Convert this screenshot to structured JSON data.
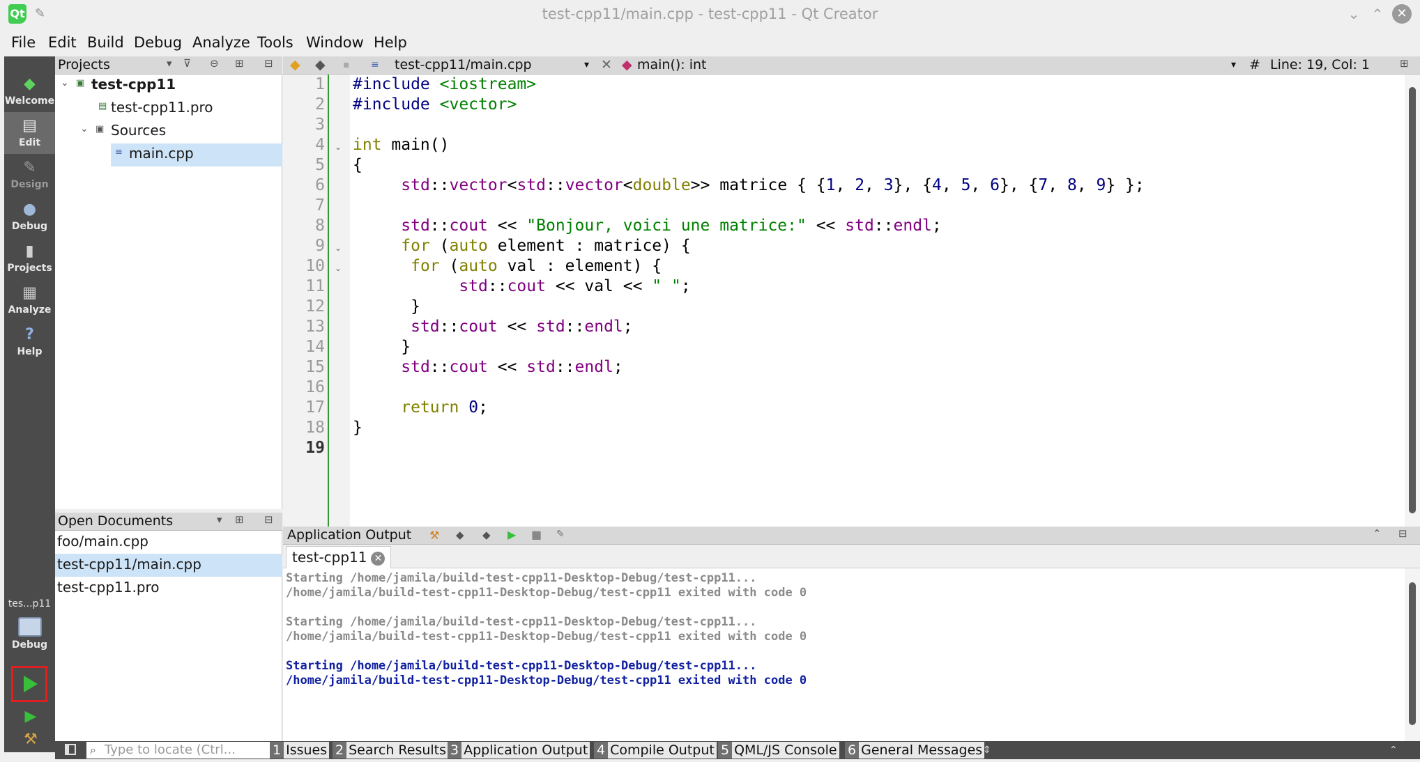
{
  "window": {
    "title": "test-cpp11/main.cpp - test-cpp11 - Qt Creator",
    "logo_text": "Qt"
  },
  "menu": [
    "File",
    "Edit",
    "Build",
    "Debug",
    "Analyze",
    "Tools",
    "Window",
    "Help"
  ],
  "modes": [
    {
      "label": "Welcome",
      "icon": "qt-welcome-icon"
    },
    {
      "label": "Edit",
      "icon": "edit-document-icon"
    },
    {
      "label": "Design",
      "icon": "design-pencil-icon"
    },
    {
      "label": "Debug",
      "icon": "debug-bug-icon"
    },
    {
      "label": "Projects",
      "icon": "projects-icon"
    },
    {
      "label": "Analyze",
      "icon": "analyze-icon"
    },
    {
      "label": "Help",
      "icon": "help-icon"
    }
  ],
  "kit": {
    "name": "tes...p11",
    "build_config": "Debug"
  },
  "projects_pane": {
    "title": "Projects",
    "tree": {
      "project": "test-cpp11",
      "pro_file": "test-cpp11.pro",
      "sources_folder": "Sources",
      "source_file": "main.cpp"
    }
  },
  "open_documents": {
    "title": "Open Documents",
    "items": [
      "foo/main.cpp",
      "test-cpp11/main.cpp",
      "test-cpp11.pro"
    ]
  },
  "editor": {
    "file_combo": "test-cpp11/main.cpp",
    "symbol_combo": "main(): int",
    "hash": "#",
    "position": "Line: 19, Col: 1",
    "line_numbers": [
      "1",
      "2",
      "3",
      "4",
      "5",
      "6",
      "7",
      "8",
      "9",
      "10",
      "11",
      "12",
      "13",
      "14",
      "15",
      "16",
      "17",
      "18",
      "19"
    ],
    "code_lines": [
      "#include <iostream>",
      "#include <vector>",
      "",
      "int main()",
      "{",
      "     std::vector<std::vector<double>> matrice { {1, 2, 3}, {4, 5, 6}, {7, 8, 9} };",
      "",
      "     std::cout << \"Bonjour, voici une matrice:\" << std::endl;",
      "     for (auto element : matrice) {",
      "      for (auto val : element) {",
      "           std::cout << val << \" \";",
      "      }",
      "      std::cout << std::endl;",
      "     }",
      "     std::cout << std::endl;",
      "",
      "     return 0;",
      "}",
      ""
    ]
  },
  "output_pane": {
    "title": "Application Output",
    "tab_label": "test-cpp11",
    "lines": [
      {
        "text": "Starting /home/jamila/build-test-cpp11-Desktop-Debug/test-cpp11...",
        "style": "gray"
      },
      {
        "text": "/home/jamila/build-test-cpp11-Desktop-Debug/test-cpp11 exited with code 0",
        "style": "gray"
      },
      {
        "text": "",
        "style": "gray"
      },
      {
        "text": "Starting /home/jamila/build-test-cpp11-Desktop-Debug/test-cpp11...",
        "style": "gray"
      },
      {
        "text": "/home/jamila/build-test-cpp11-Desktop-Debug/test-cpp11 exited with code 0",
        "style": "gray"
      },
      {
        "text": "",
        "style": "gray"
      },
      {
        "text": "Starting /home/jamila/build-test-cpp11-Desktop-Debug/test-cpp11...",
        "style": "blue"
      },
      {
        "text": "/home/jamila/build-test-cpp11-Desktop-Debug/test-cpp11 exited with code 0",
        "style": "blue"
      }
    ]
  },
  "statusbar": {
    "locator_placeholder": "Type to locate (Ctrl...",
    "buttons": [
      {
        "num": "1",
        "label": "Issues"
      },
      {
        "num": "2",
        "label": "Search Results"
      },
      {
        "num": "3",
        "label": "Application Output"
      },
      {
        "num": "4",
        "label": "Compile Output"
      },
      {
        "num": "5",
        "label": "QML/JS Console"
      },
      {
        "num": "6",
        "label": "General Messages"
      }
    ]
  },
  "colors": {
    "keyword": "#808000",
    "preprocessor": "#000080",
    "string": "#008000",
    "namespace": "#800080",
    "run_highlight": "#e02020",
    "run_green": "#38c03a"
  }
}
